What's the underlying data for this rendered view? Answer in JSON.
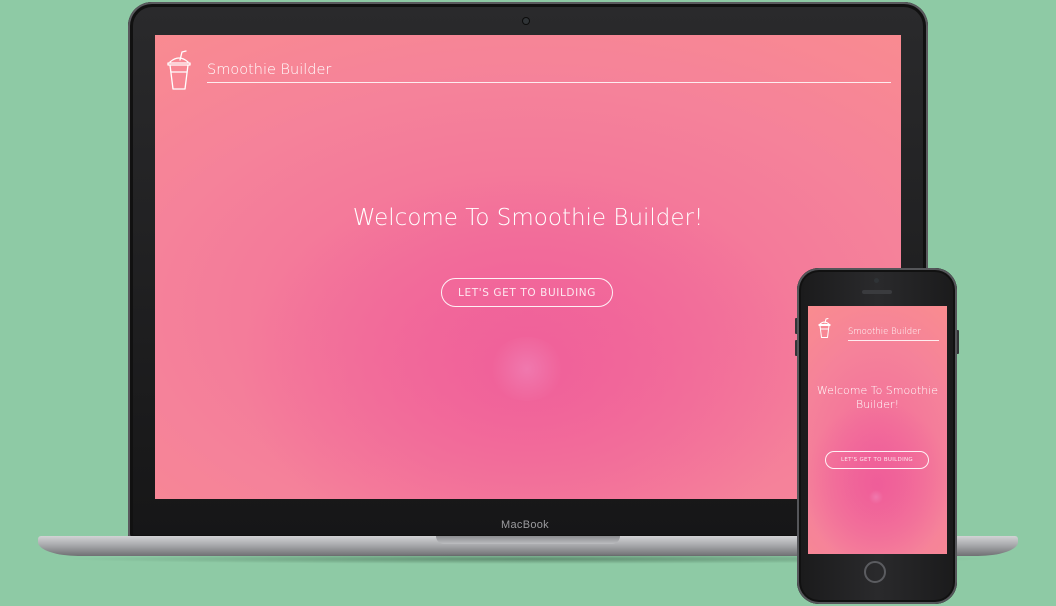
{
  "site": {
    "title": "Smoothie Builder",
    "welcome": "Welcome To Smoothie Builder!",
    "cta_label": "LET'S GET TO BUILDING"
  },
  "device": {
    "laptop_label": "MacBook"
  },
  "icons": {
    "logo": "smoothie-cup-icon"
  },
  "colors": {
    "background": "#8ecaa5",
    "gradient_center": "#f06a9a",
    "gradient_edge": "#fb8f8c",
    "text": "#ffffff"
  }
}
